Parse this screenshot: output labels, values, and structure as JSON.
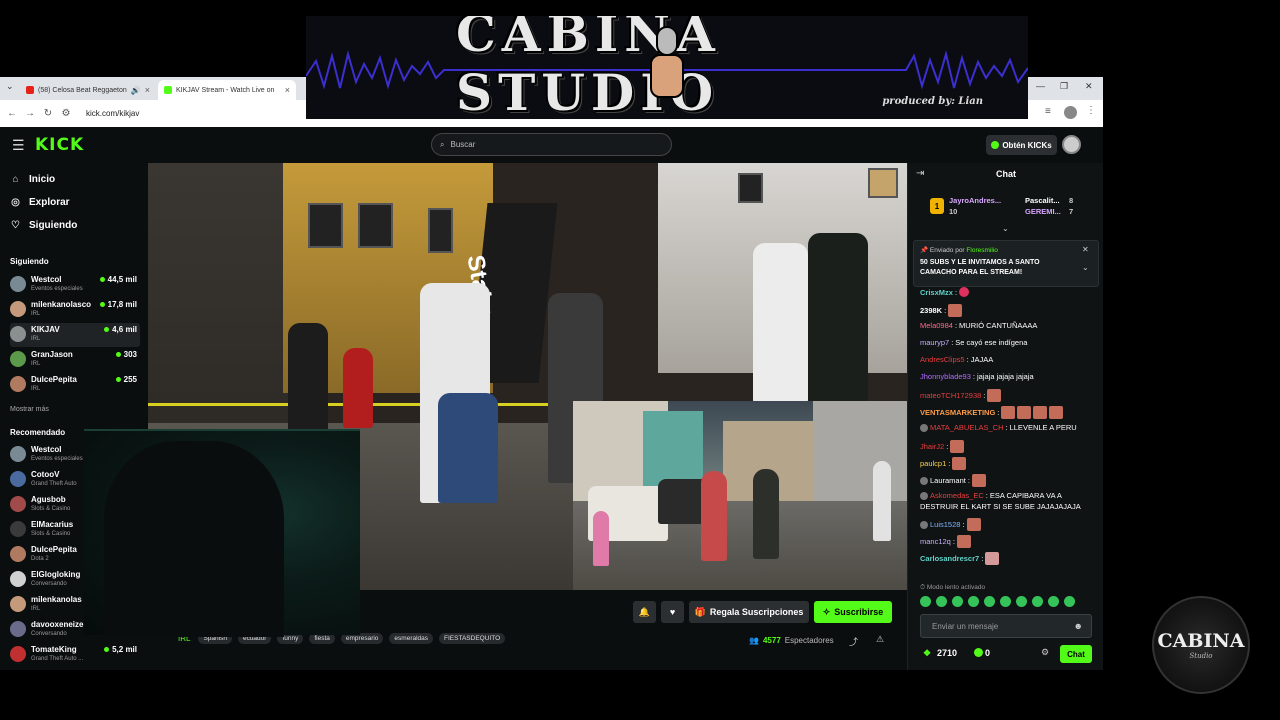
{
  "overlay": {
    "logo_text": "CABINA STUDIO",
    "logo_sub": "produced by: Lian",
    "badge_text": "CABINA",
    "badge_sub": "Studio"
  },
  "browser": {
    "tabs": [
      {
        "label": "(58) Celosa Beat Reggaeton",
        "favicon_color": "#e62117",
        "active": false
      },
      {
        "label": "KIKJAV Stream - Watch Live on",
        "favicon_color": "#53fc18",
        "active": true
      }
    ],
    "url": "kick.com/kikjav"
  },
  "kick": {
    "logo": "KICK",
    "search_placeholder": "Buscar",
    "get_kicks": "Obtén KICKs",
    "nav": [
      {
        "label": "Inicio",
        "icon": "home-icon"
      },
      {
        "label": "Explorar",
        "icon": "compass-icon"
      },
      {
        "label": "Siguiendo",
        "icon": "heart-icon"
      }
    ],
    "following_title": "Siguiendo",
    "following": [
      {
        "name": "Westcol",
        "category": "Eventos especiales",
        "viewers": "44,5 mil",
        "color": "#7a8a95"
      },
      {
        "name": "milenkanolasco",
        "category": "IRL",
        "viewers": "17,8 mil",
        "color": "#c59a7a"
      },
      {
        "name": "KIKJAV",
        "category": "IRL",
        "viewers": "4,6 mil",
        "color": "#8a8f90"
      },
      {
        "name": "GranJason",
        "category": "IRL",
        "viewers": "303",
        "color": "#5a9a4a"
      },
      {
        "name": "DulcePepita",
        "category": "IRL",
        "viewers": "255",
        "color": "#b07a60"
      }
    ],
    "show_more": "Mostrar más",
    "recommended_title": "Recomendado",
    "recommended": [
      {
        "name": "Westcol",
        "category": "Eventos especiales",
        "color": "#7a8a95"
      },
      {
        "name": "CotooV",
        "category": "Grand Theft Auto",
        "color": "#4a6aa0"
      },
      {
        "name": "Agusbob",
        "category": "Slots & Casino",
        "color": "#a04a4a"
      },
      {
        "name": "ElMacarius",
        "category": "Slots & Casino",
        "color": "#3a3a3a"
      },
      {
        "name": "DulcePepita",
        "category": "Dota 2",
        "color": "#b07a60"
      },
      {
        "name": "ElGlogloking",
        "category": "Conversando",
        "color": "#d0d0d0"
      },
      {
        "name": "milenkanolas",
        "category": "IRL",
        "color": "#c59a7a"
      },
      {
        "name": "davooxeneize",
        "category": "Conversando",
        "color": "#6a6a8a"
      },
      {
        "name": "TomateKing",
        "category": "Grand Theft Auto ...",
        "viewers": "5,2 mil",
        "color": "#c03030"
      }
    ],
    "video_banner": "Stake",
    "actions": {
      "gift_subs": "Regala Suscripciones",
      "subscribe": "Suscribirse"
    },
    "category": "IRL",
    "tags": [
      "Spanish",
      "ecuador",
      "funny",
      "fiesta",
      "empresario",
      "esmeraldas",
      "FIESTASDEQUITO"
    ],
    "viewers_count": "4577",
    "viewers_label": "Espectadores"
  },
  "chat": {
    "title": "Chat",
    "leaderboard": [
      {
        "rank": "1",
        "name": "JayroAndres...",
        "value": "10"
      },
      {
        "name": "Pascalit...",
        "value": "8"
      },
      {
        "name": "GEREMI...",
        "value": "7"
      }
    ],
    "pinned_by_label": "Enviado por",
    "pinned_user": "Floresmilio",
    "pinned_message": "50 SUBS Y LE INVITAMOS A SANTO CAMACHO PARA EL STREAM!",
    "messages": [
      {
        "user": "CrisxMzx",
        "color": "#5fd3c8",
        "text": ""
      },
      {
        "user": "2398K",
        "color": "#ffffff",
        "text": ""
      },
      {
        "user": "Mela0984",
        "color": "#ff6b8a",
        "text": "MURIÓ CANTUÑAAAA"
      },
      {
        "user": "mauryp7",
        "color": "#c9b0ff",
        "text": "Se cayó ese indígena"
      },
      {
        "user": "AndresClips5",
        "color": "#e83e3e",
        "text": "JAJAA"
      },
      {
        "user": "Jhonnyblade93",
        "color": "#b36bff",
        "text": "jajaja jajaja jajaja"
      },
      {
        "user": "mateoTCH172938",
        "color": "#e83e3e",
        "text": ""
      },
      {
        "user": "VENTASMARKETING",
        "color": "#ff9e4a",
        "text": ""
      },
      {
        "user": "MATA_ABUELAS_CH",
        "color": "#e83e3e",
        "text": "LLEVENLE A PERU"
      },
      {
        "user": "JhairJ2",
        "color": "#e83e3e",
        "text": ""
      },
      {
        "user": "paulcp1",
        "color": "#ffd24a",
        "text": ""
      },
      {
        "user": "Lauramant",
        "color": "#ffffff",
        "text": ""
      },
      {
        "user": "Askomedas_EC",
        "color": "#e83e3e",
        "text": "ESA CAPIBARA VA A"
      },
      {
        "user": "",
        "color": "#ffffff",
        "text": "DESTRUIR EL KART SI SE SUBE JAJAJAJAJA"
      },
      {
        "user": "Luis1528",
        "color": "#7fb6ff",
        "text": ""
      },
      {
        "user": "manc12q",
        "color": "#c9b0ff",
        "text": ""
      },
      {
        "user": "Carlosandrescr7",
        "color": "#5fd3c8",
        "text": ""
      }
    ],
    "slow_mode": "Modo lento activado",
    "input_placeholder": "Enviar un mensaje",
    "points": "2710",
    "kicks_balance": "0",
    "send_label": "Chat"
  }
}
